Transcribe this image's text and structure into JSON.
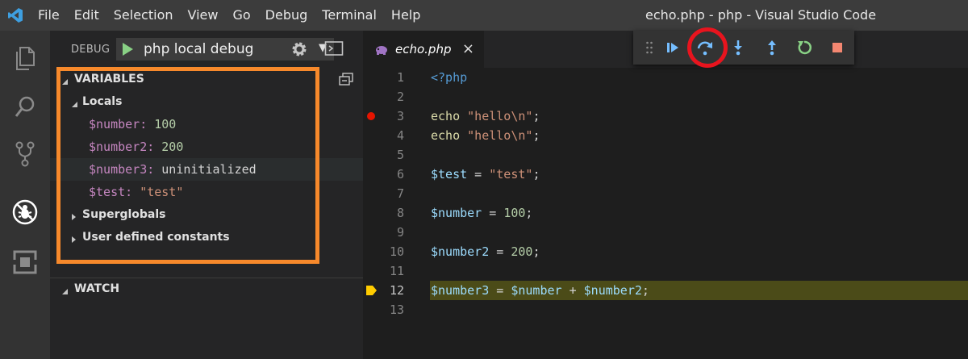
{
  "window": {
    "title": "echo.php - php - Visual Studio Code"
  },
  "menu": [
    "File",
    "Edit",
    "Selection",
    "View",
    "Go",
    "Debug",
    "Terminal",
    "Help"
  ],
  "activity_bar": [
    "explorer-icon",
    "search-icon",
    "source-control-icon",
    "debug-icon",
    "extensions-icon"
  ],
  "debug_panel": {
    "title": "DEBUG",
    "configuration": "php local debug",
    "variables_title": "VARIABLES",
    "watch_title": "WATCH",
    "locals_label": "Locals",
    "variables": [
      {
        "name": "$number:",
        "value": "100",
        "kind": "number"
      },
      {
        "name": "$number2:",
        "value": "200",
        "kind": "number"
      },
      {
        "name": "$number3:",
        "value": "uninitialized",
        "kind": "plain"
      },
      {
        "name": "$test:",
        "value": "\"test\"",
        "kind": "string"
      }
    ],
    "groups": [
      "Superglobals",
      "User defined constants"
    ]
  },
  "editor": {
    "tab_label": "echo.php",
    "tab_close": "×",
    "current_line": 12,
    "breakpoint_line": 3,
    "lines": [
      {
        "n": "1",
        "tokens": [
          {
            "t": "<?php",
            "c": "k-tag"
          }
        ]
      },
      {
        "n": "2",
        "tokens": []
      },
      {
        "n": "3",
        "tokens": [
          {
            "t": "echo ",
            "c": "k-fn"
          },
          {
            "t": "\"hello\\n\"",
            "c": "k-str"
          },
          {
            "t": ";",
            "c": "k-op"
          }
        ]
      },
      {
        "n": "4",
        "tokens": [
          {
            "t": "echo ",
            "c": "k-fn"
          },
          {
            "t": "\"hello\\n\"",
            "c": "k-str"
          },
          {
            "t": ";",
            "c": "k-op"
          }
        ]
      },
      {
        "n": "5",
        "tokens": []
      },
      {
        "n": "6",
        "tokens": [
          {
            "t": "$test",
            "c": "k-var"
          },
          {
            "t": " = ",
            "c": "k-op"
          },
          {
            "t": "\"test\"",
            "c": "k-str"
          },
          {
            "t": ";",
            "c": "k-op"
          }
        ]
      },
      {
        "n": "7",
        "tokens": []
      },
      {
        "n": "8",
        "tokens": [
          {
            "t": "$number",
            "c": "k-var"
          },
          {
            "t": " = ",
            "c": "k-op"
          },
          {
            "t": "100",
            "c": "k-num"
          },
          {
            "t": ";",
            "c": "k-op"
          }
        ]
      },
      {
        "n": "9",
        "tokens": []
      },
      {
        "n": "10",
        "tokens": [
          {
            "t": "$number2",
            "c": "k-var"
          },
          {
            "t": " = ",
            "c": "k-op"
          },
          {
            "t": "200",
            "c": "k-num"
          },
          {
            "t": ";",
            "c": "k-op"
          }
        ]
      },
      {
        "n": "11",
        "tokens": []
      },
      {
        "n": "12",
        "tokens": [
          {
            "t": "$number3",
            "c": "k-var"
          },
          {
            "t": " = ",
            "c": "k-op"
          },
          {
            "t": "$number",
            "c": "k-var"
          },
          {
            "t": " + ",
            "c": "k-op"
          },
          {
            "t": "$number2",
            "c": "k-var"
          },
          {
            "t": ";",
            "c": "k-op"
          }
        ]
      },
      {
        "n": "13",
        "tokens": []
      }
    ]
  },
  "debug_toolbar": [
    "drag-handle-icon",
    "continue-icon",
    "step-over-icon",
    "step-into-icon",
    "step-out-icon",
    "restart-icon",
    "stop-icon"
  ],
  "colors": {
    "annotation_orange": "#f7892b",
    "annotation_red": "#e8141e",
    "current_line": "#4b4b18",
    "breakpoint": "#e51400"
  }
}
